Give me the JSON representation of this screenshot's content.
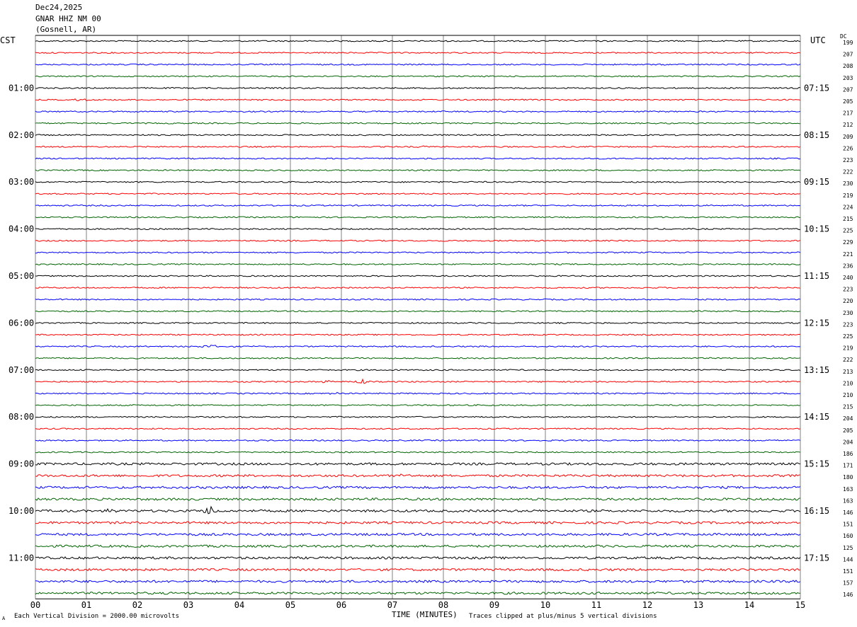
{
  "header": {
    "date": "Dec24,2025",
    "station": "GNAR HHZ NM 00",
    "location": "(Gosnell, AR)"
  },
  "left_zone": "CST",
  "right_zone": "UTC",
  "dc_label": "DC",
  "footer": {
    "left": "Each Vertical Division = 2000.00 microvolts",
    "right": "Traces clipped at plus/minus 5 vertical divisions",
    "corner": "A"
  },
  "colors": {
    "trace_cycle": [
      "#000000",
      "#ff0000",
      "#0000ff",
      "#006400"
    ],
    "grid": "#808080"
  },
  "chart_data": {
    "type": "line",
    "xlabel": "TIME (MINUTES)",
    "xlim": [
      0,
      15
    ],
    "x_ticks": [
      "00",
      "01",
      "02",
      "03",
      "04",
      "05",
      "06",
      "07",
      "08",
      "09",
      "10",
      "11",
      "12",
      "13",
      "14",
      "15"
    ],
    "left_hour_labels": [
      "01:00",
      "02:00",
      "03:00",
      "04:00",
      "05:00",
      "06:00",
      "07:00",
      "08:00",
      "09:00",
      "10:00",
      "11:00"
    ],
    "right_hour_labels": [
      "07:15",
      "08:15",
      "09:15",
      "10:15",
      "11:15",
      "12:15",
      "13:15",
      "14:15",
      "15:15",
      "16:15",
      "17:15"
    ],
    "dc_offsets": [
      199,
      207,
      208,
      203,
      207,
      205,
      217,
      212,
      209,
      226,
      223,
      222,
      230,
      219,
      224,
      215,
      225,
      229,
      221,
      236,
      240,
      223,
      220,
      230,
      223,
      225,
      219,
      222,
      213,
      210,
      210,
      215,
      204,
      205,
      204,
      186,
      171,
      180,
      163,
      163,
      146,
      151,
      160,
      125,
      144,
      151,
      157,
      146
    ],
    "trace_count": 48,
    "events": [
      {
        "trace": 5,
        "minute": 0.9,
        "amplitude": 1.5
      },
      {
        "trace": 9,
        "minute": 7.6,
        "amplitude": 1.5
      },
      {
        "trace": 29,
        "minute": 5.7,
        "amplitude": 2.5
      },
      {
        "trace": 29,
        "minute": 6.4,
        "amplitude": 3.0
      },
      {
        "trace": 30,
        "minute": 5.9,
        "amplitude": 1.5
      },
      {
        "trace": 26,
        "minute": 3.4,
        "amplitude": 3.0
      },
      {
        "trace": 37,
        "minute": 7.2,
        "amplitude": 3.0
      },
      {
        "trace": 40,
        "minute": 3.45,
        "amplitude": 9.0
      },
      {
        "trace": 40,
        "minute": 1.5,
        "amplitude": 2.5
      }
    ]
  }
}
